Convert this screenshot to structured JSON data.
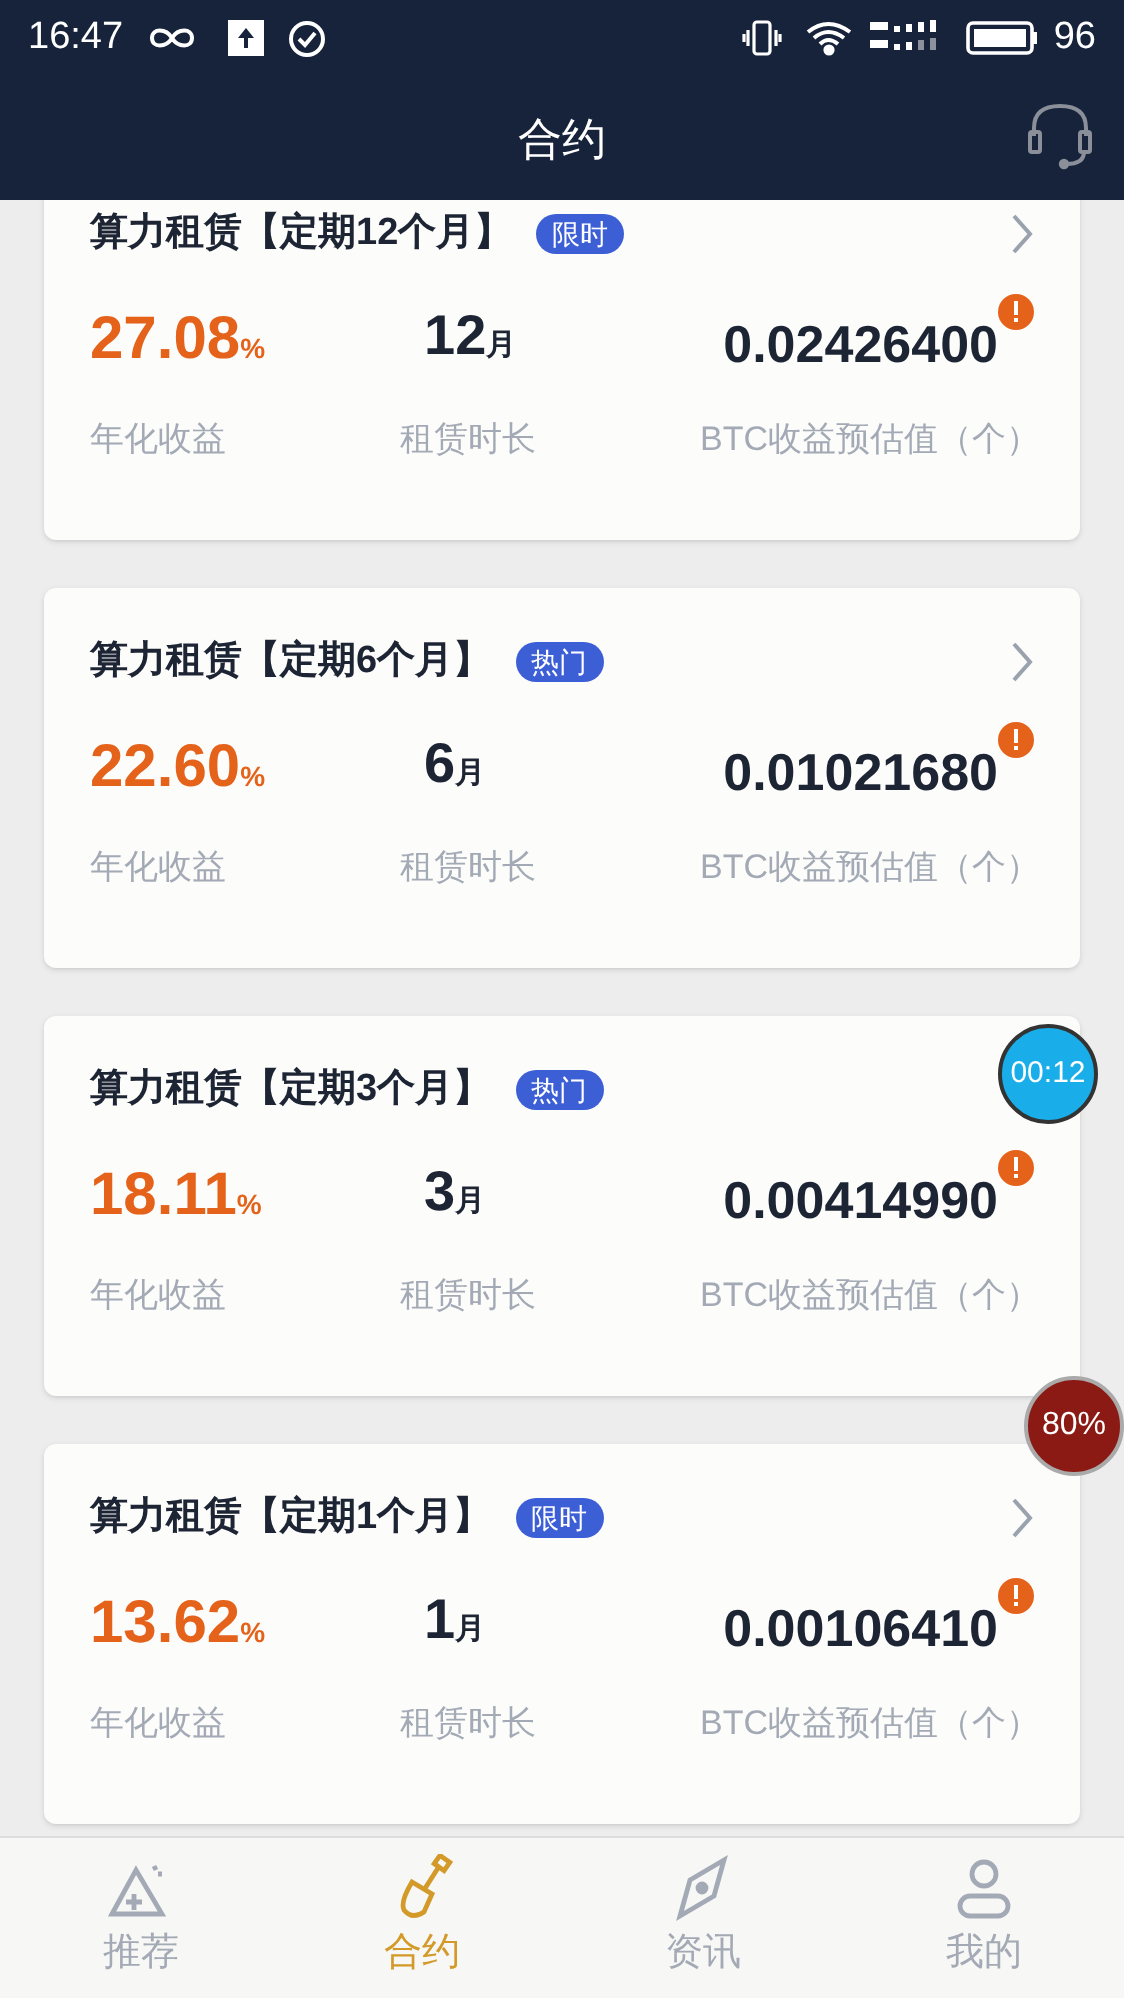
{
  "status_bar": {
    "time": "16:47",
    "battery": "96"
  },
  "header": {
    "title": "合约"
  },
  "contracts": [
    {
      "title": "算力租赁【定期12个月】",
      "tag": "限时",
      "rate": "27.08",
      "rate_unit": "%",
      "duration": "12",
      "duration_unit": "月",
      "btc": "0.02426400",
      "rate_label": "年化收益",
      "duration_label": "租赁时长",
      "btc_label": "BTC收益预估值（个）"
    },
    {
      "title": "算力租赁【定期6个月】",
      "tag": "热门",
      "rate": "22.60",
      "rate_unit": "%",
      "duration": "6",
      "duration_unit": "月",
      "btc": "0.01021680",
      "rate_label": "年化收益",
      "duration_label": "租赁时长",
      "btc_label": "BTC收益预估值（个）"
    },
    {
      "title": "算力租赁【定期3个月】",
      "tag": "热门",
      "rate": "18.11",
      "rate_unit": "%",
      "duration": "3",
      "duration_unit": "月",
      "btc": "0.00414990",
      "rate_label": "年化收益",
      "duration_label": "租赁时长",
      "btc_label": "BTC收益预估值（个）"
    },
    {
      "title": "算力租赁【定期1个月】",
      "tag": "限时",
      "rate": "13.62",
      "rate_unit": "%",
      "duration": "1",
      "duration_unit": "月",
      "btc": "0.00106410",
      "rate_label": "年化收益",
      "duration_label": "租赁时长",
      "btc_label": "BTC收益预估值（个）"
    }
  ],
  "overlays": {
    "timer": "00:12",
    "percent": "80%"
  },
  "tab_bar": [
    {
      "kind": "recommend",
      "label": "推荐",
      "selected": false
    },
    {
      "kind": "contract",
      "label": "合约",
      "selected": true
    },
    {
      "kind": "news",
      "label": "资讯",
      "selected": false
    },
    {
      "kind": "mine",
      "label": "我的",
      "selected": false
    }
  ]
}
